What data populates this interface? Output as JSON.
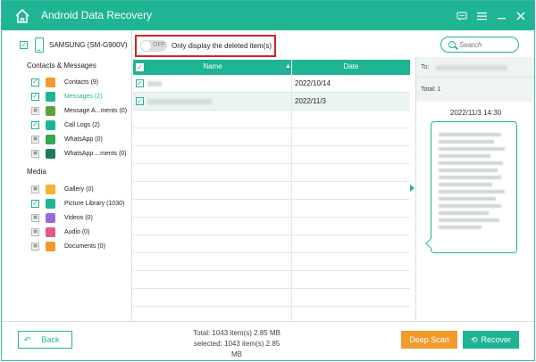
{
  "app": {
    "title": "Android Data Recovery"
  },
  "window_icons": [
    "feedback-icon",
    "menu-icon",
    "minimize-icon",
    "close-icon"
  ],
  "device": {
    "name": "SAMSUNG (SM-G900V)"
  },
  "left_panel": {
    "contacts_messages_title": "Contacts & Messages",
    "contacts_items": [
      {
        "label": "Contacts (9)",
        "icon": "contacts-icon",
        "checked": true,
        "selected": false,
        "color": "#f39a2d"
      },
      {
        "label": "Messages (2)",
        "icon": "messages-icon",
        "checked": true,
        "selected": true,
        "color": "#1fb494"
      },
      {
        "label": "Message A...ments (0)",
        "icon": "attachment-icon",
        "checked": false,
        "selected": false,
        "color": "#5fa13b"
      },
      {
        "label": "Call Logs (2)",
        "icon": "call-log-icon",
        "checked": true,
        "selected": false,
        "color": "#1fb494"
      },
      {
        "label": "WhatsApp (0)",
        "icon": "whatsapp-icon",
        "checked": false,
        "selected": false,
        "color": "#2fa84f"
      },
      {
        "label": "WhatsApp ...ments (0)",
        "icon": "whatsapp-attachment-icon",
        "checked": false,
        "selected": false,
        "color": "#1d7a5a"
      }
    ],
    "media_title": "Media",
    "media_items": [
      {
        "label": "Gallery (0)",
        "icon": "gallery-icon",
        "checked": false,
        "selected": false,
        "color": "#f3b32d"
      },
      {
        "label": "Picture Library (1030)",
        "icon": "picture-library-icon",
        "checked": true,
        "selected": false,
        "color": "#1fb494"
      },
      {
        "label": "Videos (0)",
        "icon": "videos-icon",
        "checked": false,
        "selected": false,
        "color": "#9b6ad6"
      },
      {
        "label": "Audio (0)",
        "icon": "audio-icon",
        "checked": false,
        "selected": false,
        "color": "#e05a8a"
      },
      {
        "label": "Documents (0)",
        "icon": "documents-icon",
        "checked": false,
        "selected": false,
        "color": "#f39a2d"
      }
    ]
  },
  "toggle": {
    "state": "OFF",
    "label": "Only display the deleted item(s)"
  },
  "search": {
    "placeholder": "Search"
  },
  "table": {
    "columns": [
      "Name",
      "Date"
    ],
    "rows": [
      {
        "date": "2022/10/14",
        "checked": true,
        "highlight": false
      },
      {
        "date": "2022/11/3",
        "checked": true,
        "highlight": true
      }
    ]
  },
  "detail": {
    "to_label": "To:",
    "total_label": "Total: 1",
    "timestamp": "2022/11/3  14:30"
  },
  "footer": {
    "back_label": "Back",
    "total_line": "Total: 1043 item(s) 2.85 MB",
    "selected_line": "selected: 1043 item(s) 2.85 MB",
    "deep_scan_label": "Deep Scan",
    "recover_label": "Recover"
  },
  "colors": {
    "accent": "#1fb494",
    "deep_scan": "#f39a2d",
    "highlight_box": "#d02525"
  }
}
